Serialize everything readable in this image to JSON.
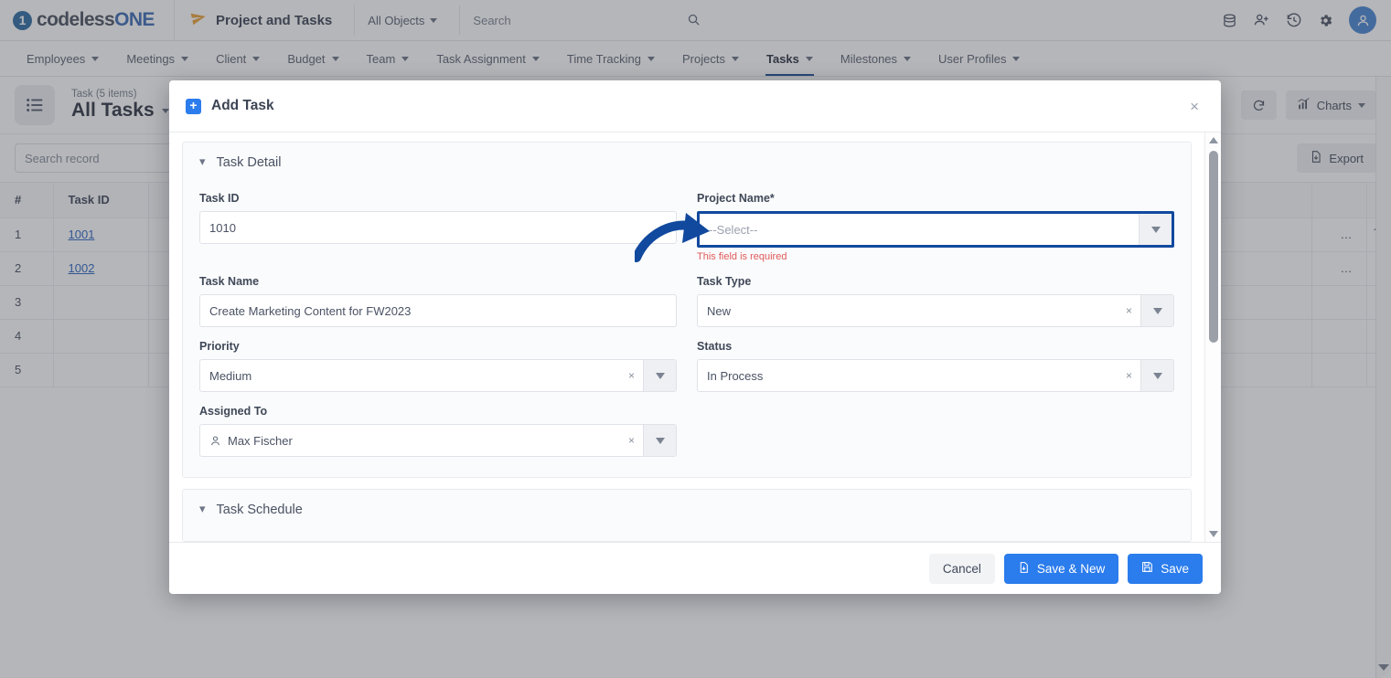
{
  "topbar": {
    "logo_first": "codeless",
    "logo_second": "ONE",
    "logo_mark": "1",
    "app_name": "Project and Tasks",
    "plane_icon": "paper-plane-icon",
    "objects_selector": "All Objects",
    "search_placeholder": "Search",
    "search_value": "",
    "icons": [
      "database-icon",
      "add-user-icon",
      "history-icon",
      "gear-icon",
      "avatar-icon"
    ]
  },
  "menubar": {
    "items": [
      {
        "label": "Employees",
        "active": false
      },
      {
        "label": "Meetings",
        "active": false
      },
      {
        "label": "Client",
        "active": false
      },
      {
        "label": "Budget",
        "active": false
      },
      {
        "label": "Team",
        "active": false
      },
      {
        "label": "Task Assignment",
        "active": false
      },
      {
        "label": "Time Tracking",
        "active": false
      },
      {
        "label": "Projects",
        "active": false
      },
      {
        "label": "Tasks",
        "active": true
      },
      {
        "label": "Milestones",
        "active": false
      },
      {
        "label": "User Profiles",
        "active": false
      }
    ]
  },
  "list_header": {
    "icon": "list-view-icon",
    "subtitle": "Task (5 items)",
    "title": "All Tasks",
    "refresh_label": "⟳",
    "charts_label": "Charts"
  },
  "search_row": {
    "record_search_placeholder": "Search record",
    "export_label": "Export"
  },
  "table": {
    "columns": [
      "#",
      "Task ID",
      "",
      "",
      ""
    ],
    "rows": [
      {
        "num": "1",
        "task_id": "1001",
        "actions": "…"
      },
      {
        "num": "2",
        "task_id": "1002",
        "actions": "…"
      },
      {
        "num": "3",
        "task_id": "",
        "actions": ""
      },
      {
        "num": "4",
        "task_id": "",
        "actions": ""
      },
      {
        "num": "5",
        "task_id": "",
        "actions": ""
      }
    ]
  },
  "modal": {
    "title": "Add Task",
    "add_icon": "+",
    "close_icon": "×",
    "sections": [
      {
        "name": "task_detail",
        "title": "Task Detail"
      },
      {
        "name": "task_schedule",
        "title": "Task Schedule"
      }
    ],
    "fields": {
      "task_id": {
        "label": "Task ID",
        "value": "1010"
      },
      "project_name": {
        "label": "Project Name*",
        "value": "",
        "placeholder": "--Select--",
        "error": "This field is required",
        "highlighted": true
      },
      "task_name": {
        "label": "Task Name",
        "value": "Create Marketing Content for FW2023"
      },
      "task_type": {
        "label": "Task Type",
        "value": "New"
      },
      "priority": {
        "label": "Priority",
        "value": "Medium"
      },
      "status": {
        "label": "Status",
        "value": "In Process"
      },
      "assigned_to": {
        "label": "Assigned To",
        "value": "Max Fischer"
      }
    },
    "buttons": {
      "cancel": "Cancel",
      "save_and_new": "Save & New",
      "save": "Save"
    }
  },
  "colors": {
    "accent_blue": "#2b7cec",
    "highlight_border": "#11499e",
    "error_red": "#e05a5a",
    "link_blue": "#2f67c4",
    "logo_blue": "#3e6db5",
    "plane_orange": "#e8a33d"
  }
}
